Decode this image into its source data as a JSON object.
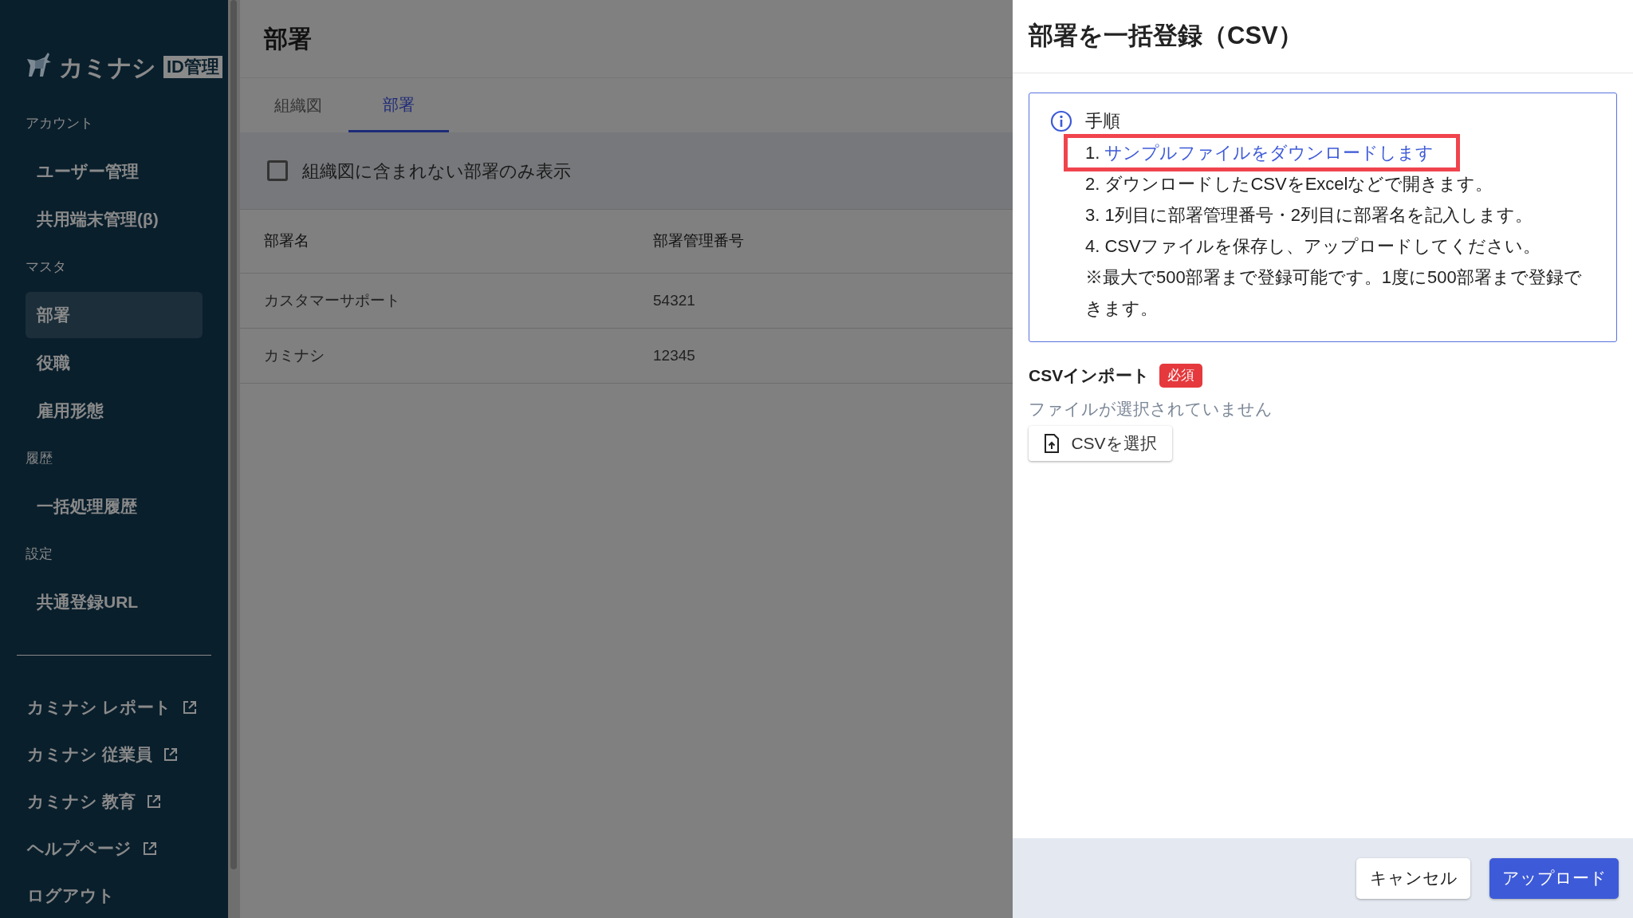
{
  "sidebar": {
    "logo": {
      "brand": "カミナシ",
      "badge": "ID管理"
    },
    "sections": [
      {
        "label": "アカウント",
        "items": [
          {
            "label": "ユーザー管理",
            "selected": false
          },
          {
            "label": "共用端末管理(β)",
            "selected": false
          }
        ]
      },
      {
        "label": "マスタ",
        "items": [
          {
            "label": "部署",
            "selected": true
          },
          {
            "label": "役職",
            "selected": false
          },
          {
            "label": "雇用形態",
            "selected": false
          }
        ]
      },
      {
        "label": "履歴",
        "items": [
          {
            "label": "一括処理履歴",
            "selected": false
          }
        ]
      },
      {
        "label": "設定",
        "items": [
          {
            "label": "共通登録URL",
            "selected": false
          }
        ]
      }
    ],
    "links": [
      {
        "label": "カミナシ レポート",
        "external": true
      },
      {
        "label": "カミナシ 従業員",
        "external": true
      },
      {
        "label": "カミナシ 教育",
        "external": true
      },
      {
        "label": "ヘルプページ",
        "external": true
      },
      {
        "label": "ログアウト",
        "external": false
      }
    ]
  },
  "main": {
    "title": "部署",
    "tabs": [
      {
        "label": "組織図",
        "selected": false
      },
      {
        "label": "部署",
        "selected": true
      }
    ],
    "filter": {
      "label": "組織図に含まれない部署のみ表示",
      "checked": false
    },
    "table": {
      "columns": [
        "部署名",
        "部署管理番号"
      ],
      "rows": [
        [
          "カスタマーサポート",
          "54321"
        ],
        [
          "カミナシ",
          "12345"
        ]
      ]
    }
  },
  "dialog": {
    "title": "部署を一括登録（CSV）",
    "info": {
      "heading": "手順",
      "steps": [
        {
          "number": "1.",
          "text": "サンプルファイルをダウンロードします",
          "kind": "link",
          "highlighted": true
        },
        {
          "number": "2.",
          "text": "ダウンロードしたCSVをExcelなどで開きます。",
          "kind": "text",
          "highlighted": false
        },
        {
          "number": "3.",
          "text": "1列目に部署管理番号・2列目に部署名を記入します。",
          "kind": "text",
          "highlighted": false
        },
        {
          "number": "4.",
          "text": "CSVファイルを保存し、アップロードしてください。",
          "kind": "text",
          "highlighted": false
        }
      ],
      "note": "※最大で500部署まで登録可能です。1度に500部署まで登録できます。"
    },
    "import": {
      "label": "CSVインポート",
      "badge": "必須",
      "status": "ファイルが選択されていません",
      "button": "CSVを選択"
    },
    "buttons": [
      {
        "label": "キャンセル",
        "kind": "secondary"
      },
      {
        "label": "アップロード",
        "kind": "primary"
      }
    ]
  }
}
